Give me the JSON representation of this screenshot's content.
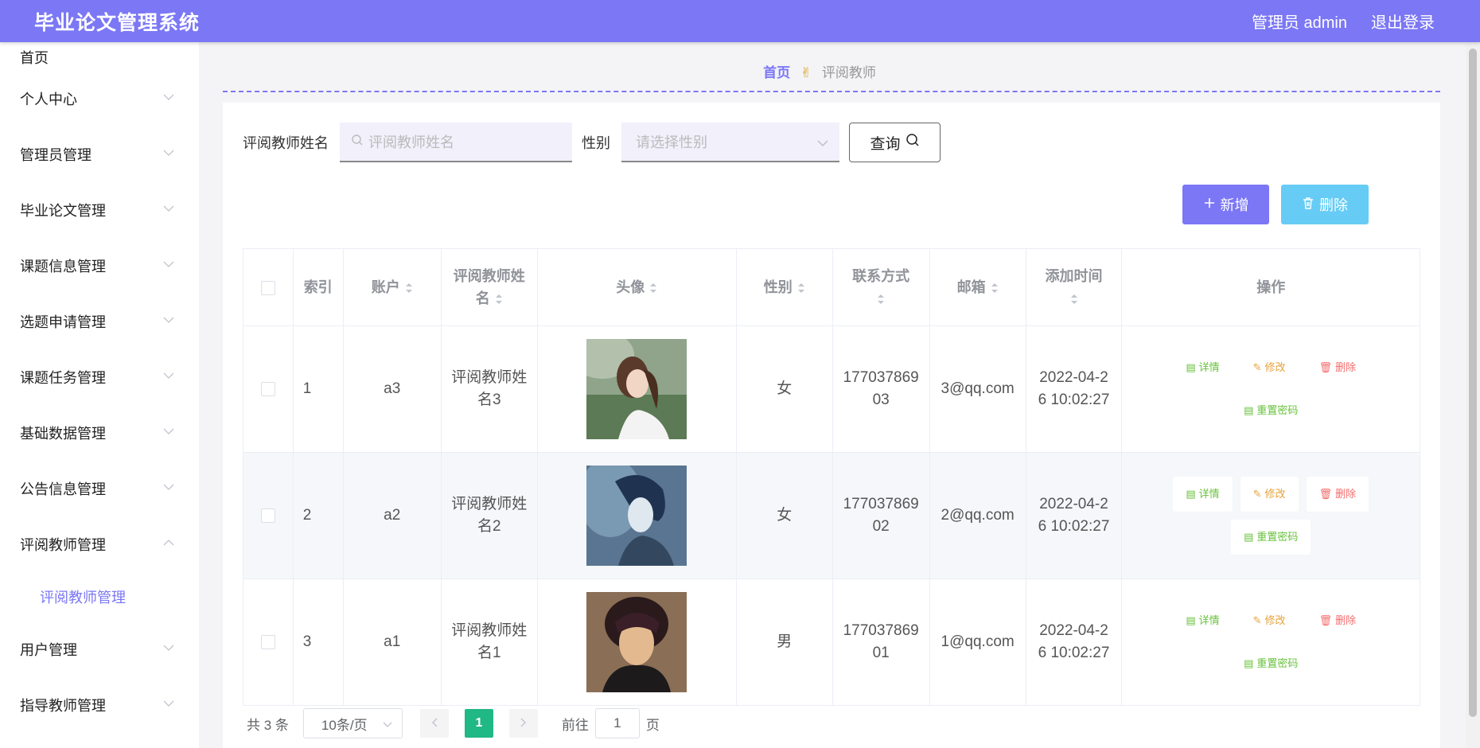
{
  "header": {
    "title": "毕业论文管理系统",
    "user_label": "管理员 admin",
    "logout_label": "退出登录"
  },
  "sidebar": {
    "items": [
      {
        "label": "首页"
      },
      {
        "label": "个人中心"
      },
      {
        "label": "管理员管理"
      },
      {
        "label": "毕业论文管理"
      },
      {
        "label": "课题信息管理"
      },
      {
        "label": "选题申请管理"
      },
      {
        "label": "课题任务管理"
      },
      {
        "label": "基础数据管理"
      },
      {
        "label": "公告信息管理"
      },
      {
        "label": "评阅教师管理"
      },
      {
        "label": "用户管理"
      },
      {
        "label": "指导教师管理"
      }
    ],
    "active_sub": "评阅教师管理"
  },
  "breadcrumb": {
    "home": "首页",
    "current": "评阅教师"
  },
  "search": {
    "name_label": "评阅教师姓名",
    "name_placeholder": "评阅教师姓名",
    "gender_label": "性别",
    "gender_placeholder": "请选择性别",
    "query_label": "查询"
  },
  "actions": {
    "add_label": "新增",
    "delete_label": "删除"
  },
  "table": {
    "headers": {
      "index": "索引",
      "account": "账户",
      "name_l1": "评阅教师姓",
      "name_l2": "名",
      "avatar": "头像",
      "gender": "性别",
      "contact": "联系方式",
      "email": "邮箱",
      "added_time": "添加时间",
      "ops": "操作"
    },
    "rows": [
      {
        "index": "1",
        "account": "a3",
        "name_l1": "评阅教师姓",
        "name_l2": "名3",
        "gender": "女",
        "phone_l1": "177037869",
        "phone_l2": "03",
        "email": "3@qq.com",
        "time_l1": "2022-04-2",
        "time_l2": "6 10:02:27"
      },
      {
        "index": "2",
        "account": "a2",
        "name_l1": "评阅教师姓",
        "name_l2": "名2",
        "gender": "女",
        "phone_l1": "177037869",
        "phone_l2": "02",
        "email": "2@qq.com",
        "time_l1": "2022-04-2",
        "time_l2": "6 10:02:27"
      },
      {
        "index": "3",
        "account": "a1",
        "name_l1": "评阅教师姓",
        "name_l2": "名1",
        "gender": "男",
        "phone_l1": "177037869",
        "phone_l2": "01",
        "email": "1@qq.com",
        "time_l1": "2022-04-2",
        "time_l2": "6 10:02:27"
      }
    ],
    "op_labels": {
      "detail": "详情",
      "edit": "修改",
      "delete": "删除",
      "reset": "重置密码"
    }
  },
  "pagination": {
    "total": "共 3 条",
    "page_size": "10条/页",
    "current_page": "1",
    "goto_label": "前往",
    "goto_value": "1",
    "page_suffix": "页"
  },
  "colors": {
    "accent": "#7b77f5",
    "delete_button": "#66ccf5",
    "page_active": "#20b885"
  }
}
